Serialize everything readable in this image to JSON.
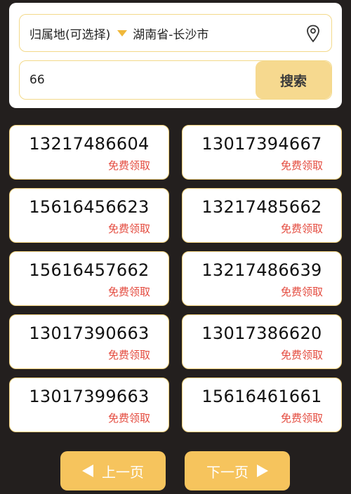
{
  "filter": {
    "region_label": "归属地(可选择)",
    "region_value": "湖南省-长沙市",
    "icons": {
      "dropdown": "caret-down-icon",
      "location": "location-pin-icon"
    }
  },
  "search": {
    "value": "66",
    "button_label": "搜索"
  },
  "numbers": [
    {
      "number": "13217486604",
      "action": "免费领取"
    },
    {
      "number": "13017394667",
      "action": "免费领取"
    },
    {
      "number": "15616456623",
      "action": "免费领取"
    },
    {
      "number": "13217485662",
      "action": "免费领取"
    },
    {
      "number": "15616457662",
      "action": "免费领取"
    },
    {
      "number": "13217486639",
      "action": "免费领取"
    },
    {
      "number": "13017390663",
      "action": "免费领取"
    },
    {
      "number": "13017386620",
      "action": "免费领取"
    },
    {
      "number": "13017399663",
      "action": "免费领取"
    },
    {
      "number": "15616461661",
      "action": "免费领取"
    }
  ],
  "pagination": {
    "prev_label": "上一页",
    "next_label": "下一页"
  },
  "colors": {
    "background": "#231f1e",
    "accent": "#f6c45d",
    "claim_text": "#e44b3f"
  }
}
